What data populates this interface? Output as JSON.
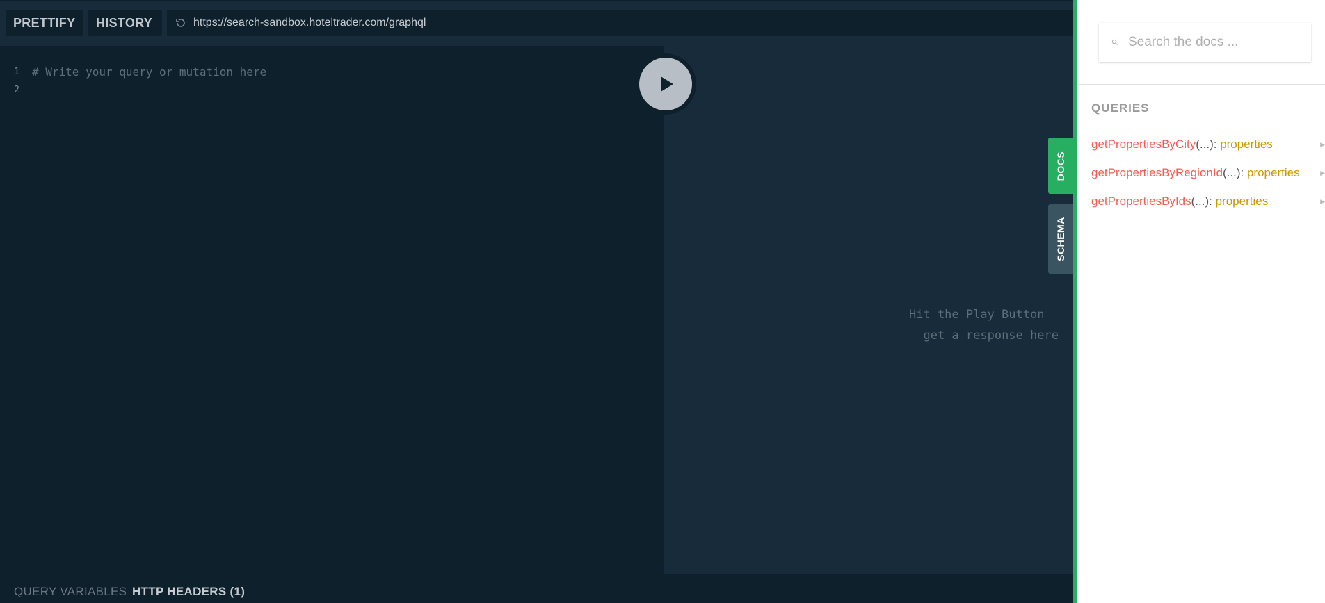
{
  "toolbar": {
    "prettify_label": "PRETTIFY",
    "history_label": "HISTORY",
    "endpoint_url": "https://search-sandbox.hoteltrader.com/graphql"
  },
  "editor": {
    "line_numbers": [
      "1",
      "2"
    ],
    "placeholder_comment": "# Write your query or mutation here"
  },
  "result": {
    "hint_line1": "Hit the Play Button",
    "hint_line2": "get a response here"
  },
  "bottom_tabs": {
    "query_variables": "QUERY VARIABLES",
    "http_headers": "HTTP HEADERS (1)"
  },
  "side_tabs": {
    "docs": "DOCS",
    "schema": "SCHEMA"
  },
  "docs_panel": {
    "search_placeholder": "Search the docs ...",
    "section_title": "QUERIES",
    "queries": [
      {
        "name": "getPropertiesByCity",
        "args": "(...)",
        "colon": ": ",
        "type": "properties"
      },
      {
        "name": "getPropertiesByRegionId",
        "args": "(...)",
        "colon": ": ",
        "type": "properties"
      },
      {
        "name": "getPropertiesByIds",
        "args": "(...)",
        "colon": ": ",
        "type": "properties"
      }
    ]
  },
  "colors": {
    "accent_green": "#27ae60",
    "editor_bg": "#0f202d",
    "result_bg": "#172b3a",
    "field_name": "#f25c54",
    "type_name": "#ca9800"
  },
  "icons": {
    "reload": "reload-icon",
    "play": "play-icon",
    "search": "search-icon",
    "arrow": "arrow-right-icon"
  }
}
